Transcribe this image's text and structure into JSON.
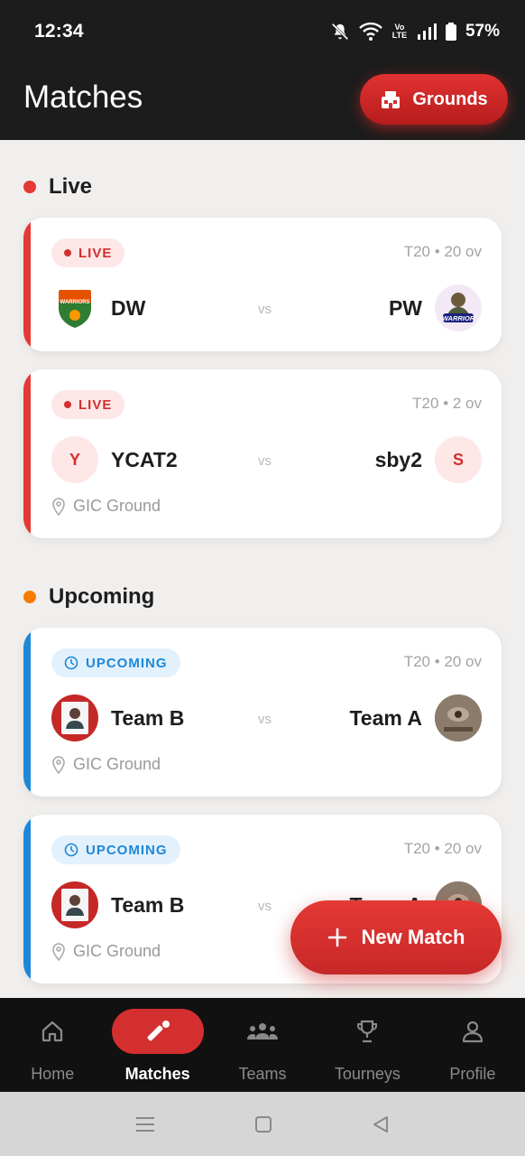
{
  "status_bar": {
    "time": "12:34",
    "volte": "Vo LTE",
    "battery": "57%"
  },
  "header": {
    "title": "Matches",
    "grounds_label": "Grounds"
  },
  "sections": {
    "live_label": "Live",
    "upcoming_label": "Upcoming"
  },
  "colors": {
    "brand_red": "#d32f2f",
    "live_accent": "#e53935",
    "upcoming_accent": "#1e88d8",
    "upcoming_dot": "#f57c00"
  },
  "matches": [
    {
      "status": "LIVE",
      "format": "T20 • 20 ov",
      "team_left": "DW",
      "team_right": "PW",
      "vs": "vs",
      "left_logo_text": "WARRIORS",
      "right_logo_text": "WARRIOR"
    },
    {
      "status": "LIVE",
      "format": "T20 • 2 ov",
      "team_left": "YCAT2",
      "left_initial": "Y",
      "team_right": "sby2",
      "right_initial": "S",
      "vs": "vs",
      "ground": "GIC Ground"
    },
    {
      "status": "UPCOMING",
      "format": "T20 • 20 ov",
      "team_left": "Team B",
      "team_right": "Team A",
      "vs": "vs",
      "ground": "GIC Ground"
    },
    {
      "status": "UPCOMING",
      "format": "T20 • 20 ov",
      "team_left": "Team B",
      "team_right": "Team A",
      "vs": "vs",
      "ground": "GIC Ground"
    }
  ],
  "fab": {
    "label": "New Match"
  },
  "bottom_nav": [
    {
      "label": "Home",
      "icon": "home-icon",
      "active": false
    },
    {
      "label": "Matches",
      "icon": "cricket-icon",
      "active": true
    },
    {
      "label": "Teams",
      "icon": "teams-icon",
      "active": false
    },
    {
      "label": "Tourneys",
      "icon": "trophy-icon",
      "active": false
    },
    {
      "label": "Profile",
      "icon": "profile-icon",
      "active": false
    }
  ]
}
